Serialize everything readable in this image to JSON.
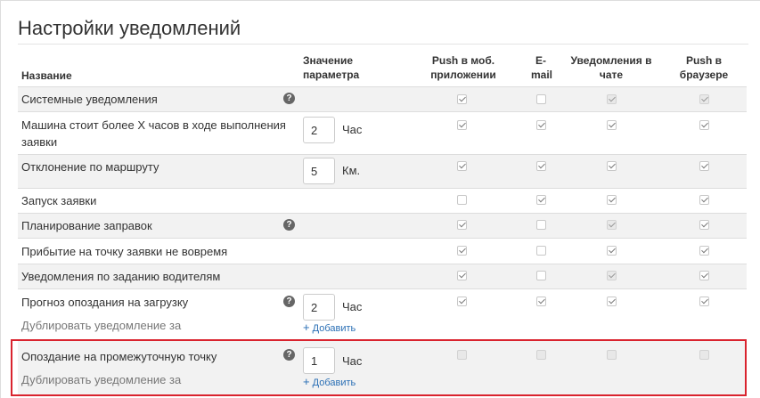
{
  "page": {
    "title": "Настройки уведомлений"
  },
  "columns": {
    "name": "Название",
    "value": "Значение параметра",
    "push_mobile": "Push в моб. приложении",
    "email": "E-mail",
    "chat": "Уведомления в чате",
    "push_browser": "Push в браузере"
  },
  "rows": [
    {
      "name": "Системные уведомления",
      "help": true,
      "checks": {
        "push_mobile": "checked",
        "email": "unchecked",
        "chat": "disabled-checked",
        "push_browser": "disabled-checked"
      }
    },
    {
      "name": "Машина стоит более X часов в ходе выполнения заявки",
      "value": "2",
      "unit": "Час",
      "checks": {
        "push_mobile": "checked",
        "email": "checked",
        "chat": "checked",
        "push_browser": "checked"
      }
    },
    {
      "name": "Отклонение по маршруту",
      "value": "5",
      "unit": "Км.",
      "checks": {
        "push_mobile": "checked",
        "email": "checked",
        "chat": "checked",
        "push_browser": "checked"
      }
    },
    {
      "name": "Запуск заявки",
      "checks": {
        "push_mobile": "unchecked",
        "email": "checked",
        "chat": "checked",
        "push_browser": "checked"
      }
    },
    {
      "name": "Планирование заправок",
      "help": true,
      "checks": {
        "push_mobile": "checked",
        "email": "unchecked",
        "chat": "disabled-checked",
        "push_browser": "checked"
      }
    },
    {
      "name": "Прибытие на точку заявки не вовремя",
      "checks": {
        "push_mobile": "checked",
        "email": "unchecked",
        "chat": "checked",
        "push_browser": "checked"
      }
    },
    {
      "name": "Уведомления по заданию водителям",
      "checks": {
        "push_mobile": "checked",
        "email": "unchecked",
        "chat": "disabled-checked",
        "push_browser": "checked"
      }
    },
    {
      "name": "Прогноз опоздания на загрузку",
      "help": true,
      "value": "2",
      "unit": "Час",
      "sub": "Дублировать уведомление за",
      "add": "Добавить",
      "checks": {
        "push_mobile": "checked",
        "email": "checked",
        "chat": "checked",
        "push_browser": "checked"
      }
    },
    {
      "name": "Опоздание на промежуточную точку",
      "help": true,
      "value": "1",
      "unit": "Час",
      "sub": "Дублировать уведомление за",
      "add": "Добавить",
      "checks": {
        "push_mobile": "unchecked",
        "email": "unchecked",
        "chat": "unchecked",
        "push_browser": "unchecked"
      }
    }
  ],
  "icons": {
    "help": "question-circle-icon",
    "add": "plus-icon",
    "check": "check-icon"
  },
  "colors": {
    "highlight": "#d9232e",
    "link": "#2a6fb5",
    "row_alt": "#f2f2f2"
  }
}
